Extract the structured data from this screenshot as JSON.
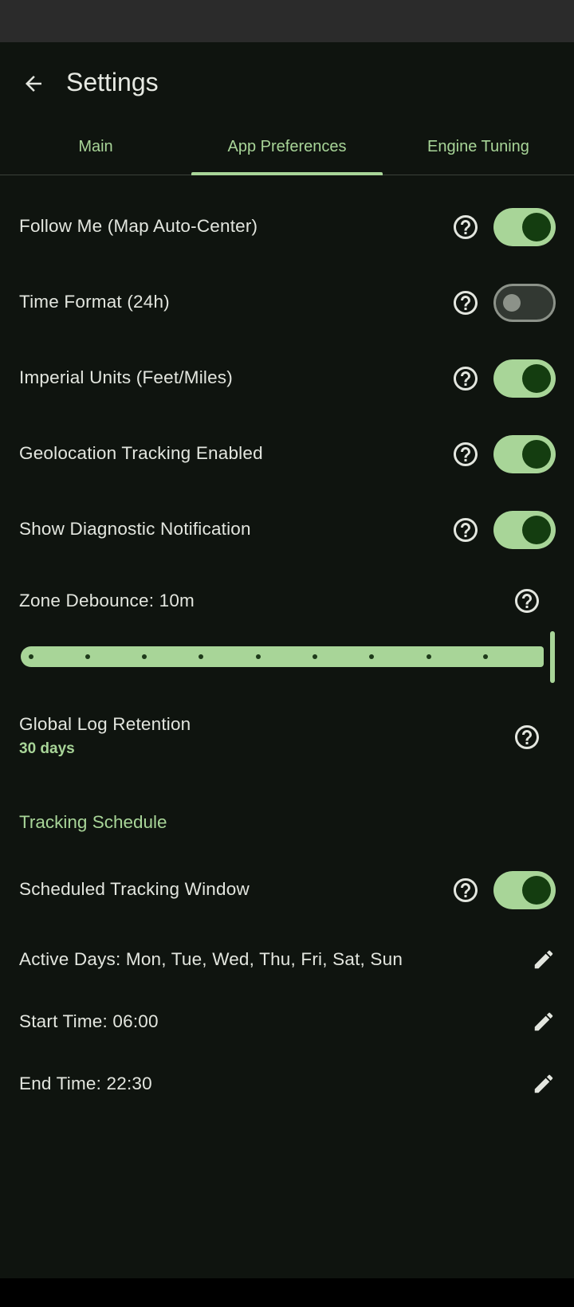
{
  "header": {
    "title": "Settings"
  },
  "tabs": [
    {
      "label": "Main"
    },
    {
      "label": "App Preferences"
    },
    {
      "label": "Engine Tuning"
    }
  ],
  "settings": [
    {
      "label": "Follow Me (Map Auto-Center)",
      "enabled": true
    },
    {
      "label": "Time Format (24h)",
      "enabled": false
    },
    {
      "label": "Imperial Units (Feet/Miles)",
      "enabled": true
    },
    {
      "label": "Geolocation Tracking Enabled",
      "enabled": true
    },
    {
      "label": "Show Diagnostic Notification",
      "enabled": true
    }
  ],
  "zone_debounce": {
    "label": "Zone Debounce: 10m",
    "slider_position": 1.0
  },
  "log_retention": {
    "label": "Global Log Retention",
    "value": "30 days"
  },
  "tracking_schedule": {
    "section_title": "Tracking Schedule",
    "window_label": "Scheduled Tracking Window",
    "window_enabled": true,
    "active_days": "Active Days: Mon, Tue, Wed, Thu, Fri, Sat, Sun",
    "start_time": "Start Time: 06:00",
    "end_time": "End Time: 22:30"
  },
  "colors": {
    "accent": "#a8d598",
    "background": "#0f140f",
    "knob_on": "#143d10"
  },
  "icons": [
    "arrow-back-icon",
    "help-circle-icon",
    "pencil-edit-icon"
  ]
}
